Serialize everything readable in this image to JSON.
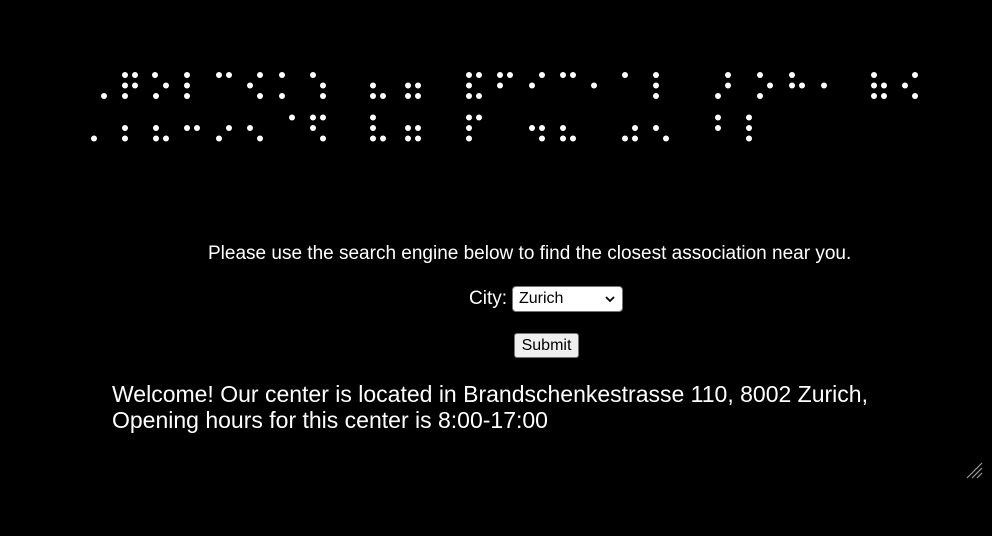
{
  "page": {
    "background": "#000000",
    "text_color": "#ffffff"
  },
  "banner": {
    "type": "braille-dot-pattern",
    "dot_color": "#ffffff"
  },
  "intro_text": "Please use the search engine below to find the closest association near you.",
  "form": {
    "city_label": "City:",
    "city_selected": "Zurich",
    "submit_label": "Submit"
  },
  "welcome_text": "Welcome! Our center is located in Brandschenkestrasse 110, 8002 Zurich, Opening hours for this center is 8:00-17:00",
  "icons": {
    "dropdown": "chevron-down-icon",
    "resize": "resize-grip-icon"
  }
}
